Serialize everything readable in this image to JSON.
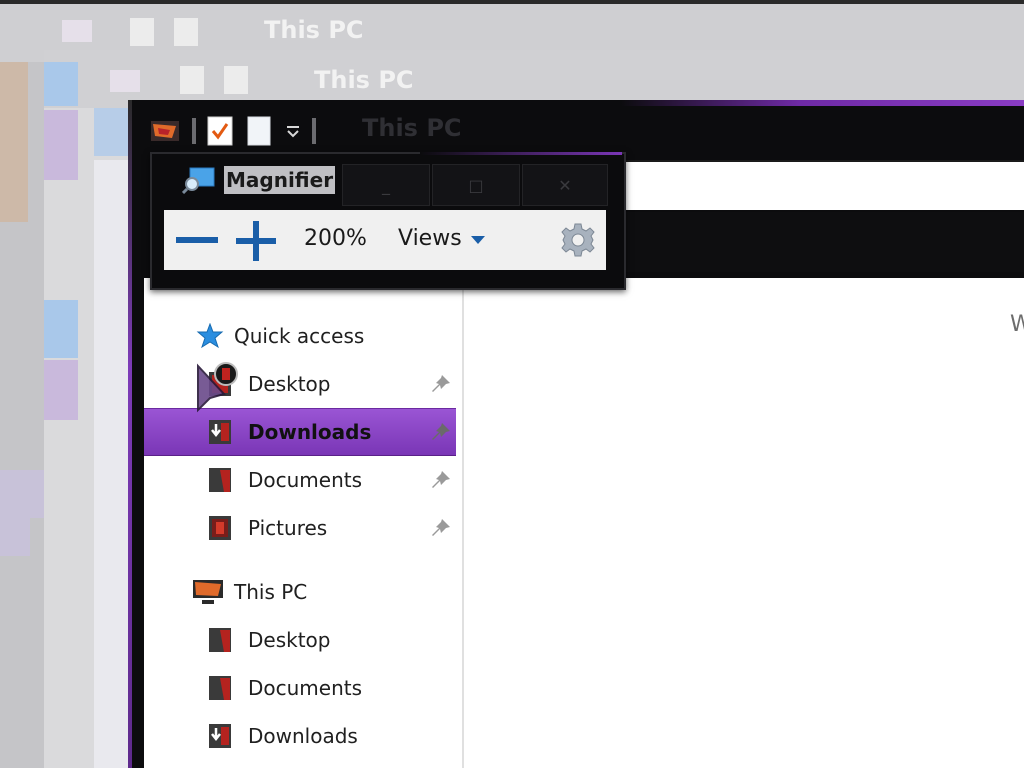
{
  "window_title": "This PC",
  "magnifier": {
    "title": "Magnifier",
    "zoom_level": "200%",
    "views_label": "Views",
    "min_glyph": "_",
    "max_glyph": "□",
    "close_glyph": "✕"
  },
  "nav": {
    "quick_access": "Quick access",
    "quick_items": [
      {
        "label": "Desktop",
        "pinned": true
      },
      {
        "label": "Downloads",
        "pinned": true,
        "selected": true
      },
      {
        "label": "Documents",
        "pinned": true
      },
      {
        "label": "Pictures",
        "pinned": true
      }
    ],
    "this_pc": "This PC",
    "pc_items": [
      {
        "label": "Desktop"
      },
      {
        "label": "Documents"
      },
      {
        "label": "Downloads"
      }
    ]
  },
  "content": {
    "partial_letter": "W"
  },
  "colors": {
    "accent_purple": "#7a36b6",
    "window_dark": "#0c0c0e",
    "magnifier_blue": "#1a5ea8"
  },
  "icons": [
    "app-icon",
    "properties-icon",
    "new-folder-icon",
    "dropdown-icon",
    "magnifier-icon",
    "zoom-out-icon",
    "zoom-in-icon",
    "views-caret-icon",
    "settings-gear-icon",
    "star-icon",
    "desktop-folder-icon",
    "downloads-folder-icon",
    "documents-folder-icon",
    "pictures-folder-icon",
    "pin-icon",
    "this-pc-icon",
    "mouse-cursor-icon"
  ]
}
